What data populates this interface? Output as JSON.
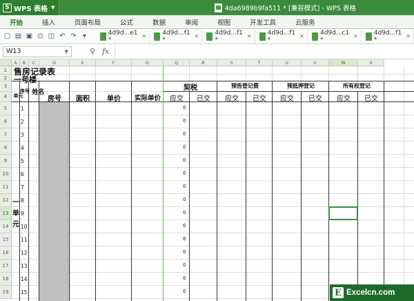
{
  "app": {
    "name": "WPS 表格",
    "logo_letter": "S"
  },
  "window_title": "4da6989b9fa511 * [兼容模式] - WPS 表格",
  "ribbon_tabs": [
    "开始",
    "插入",
    "页面布局",
    "公式",
    "数据",
    "审阅",
    "视图",
    "开发工具",
    "云服务"
  ],
  "active_tab": "开始",
  "doc_tabs": [
    "4d9d...e1 *",
    "4d9d...f1 *",
    "4d9d...f1 *",
    "4d9d...f1 *",
    "4d9d...c1 *",
    "4d9d...f1 *"
  ],
  "formula_bar": {
    "cell_ref": "W13",
    "fx_label": "fx",
    "value": ""
  },
  "column_letters": [
    "A",
    "B",
    "C",
    "D",
    "E",
    "F",
    "G",
    "Q",
    "R",
    "S",
    "T",
    "U",
    "V",
    "W",
    "X"
  ],
  "selected_column": "W",
  "row_numbers": [
    "1",
    "2",
    "3",
    "4",
    "5",
    "6",
    "7",
    "8",
    "9",
    "10",
    "11",
    "12",
    "13",
    "14",
    "15",
    "16",
    "17",
    "18",
    "19"
  ],
  "selected_row": "13",
  "sheet": {
    "title": "售房记录表",
    "building": "一号楼",
    "headers": {
      "unit": "单元",
      "seq": "序号",
      "name": "姓名",
      "room": "房号",
      "area": "面积",
      "price": "单价",
      "actual_price": "实际单价",
      "deed_tax": "契税",
      "pre_reg": "预告登记费",
      "mortgage": "预抵押登记",
      "ownership": "所有权登记",
      "should": "应交",
      "paid": "已交"
    },
    "unit_label": "一单元",
    "seq_numbers": [
      "1",
      "2",
      "3",
      "4",
      "5",
      "6",
      "7",
      "8",
      "9",
      "10",
      "11",
      "12",
      "13",
      "14",
      "15"
    ],
    "deed_tax_values": [
      "0",
      "0",
      "0",
      "0",
      "0",
      "0",
      "0",
      "0",
      "0",
      "0",
      "0",
      "0",
      "0",
      "0",
      "0"
    ]
  },
  "watermark": {
    "letter": "E",
    "text": "Excelcn.com"
  }
}
